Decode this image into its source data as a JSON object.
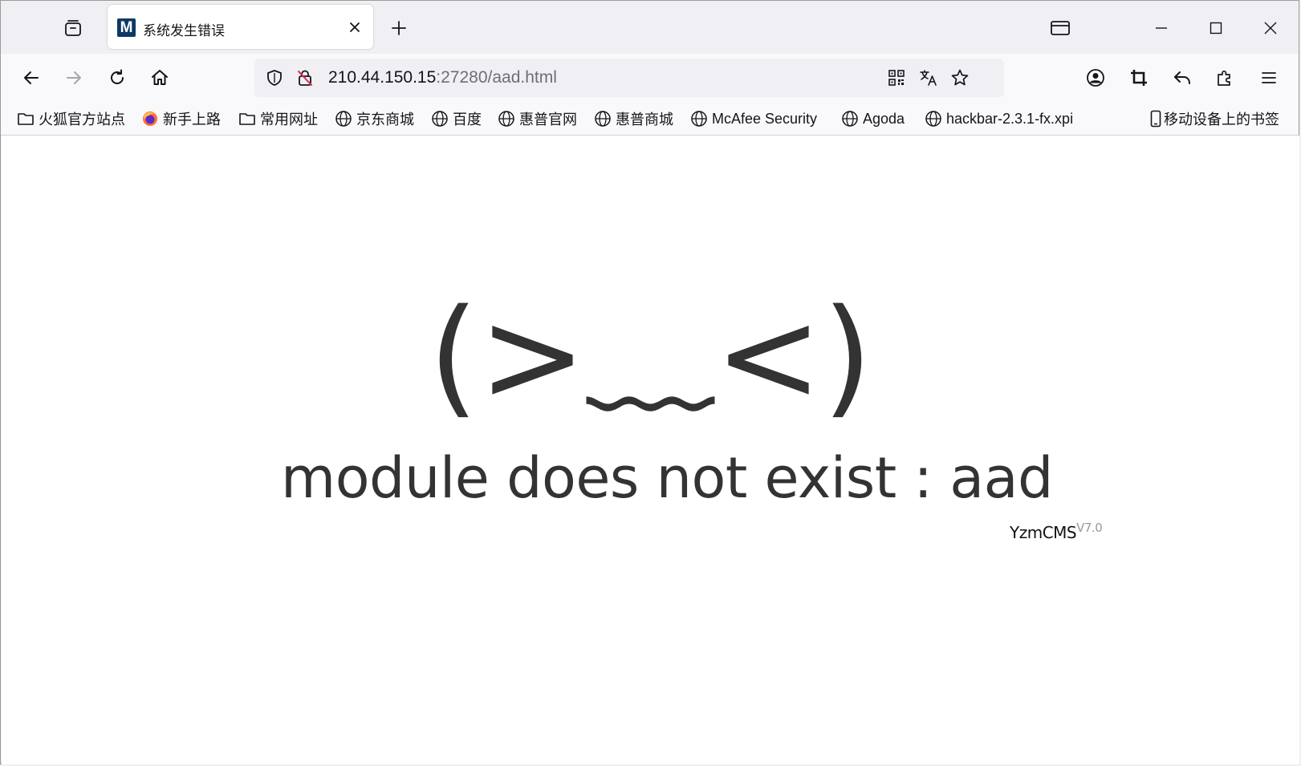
{
  "browser": {
    "tab": {
      "favicon_letter": "M",
      "title": "系统发生错误"
    },
    "address": {
      "host": "210.44.150.15",
      "rest": ":27280/aad.html"
    },
    "bookmarks": [
      {
        "label": "火狐官方站点",
        "icon": "folder-icon"
      },
      {
        "label": "新手上路",
        "icon": "firefox-icon"
      },
      {
        "label": "常用网址",
        "icon": "folder-icon"
      },
      {
        "label": "京东商城",
        "icon": "globe-icon"
      },
      {
        "label": "百度",
        "icon": "globe-icon"
      },
      {
        "label": "惠普官网",
        "icon": "globe-icon"
      },
      {
        "label": "惠普商城",
        "icon": "globe-icon"
      },
      {
        "label": "McAfee Security",
        "icon": "globe-icon"
      },
      {
        "label": "Agoda",
        "icon": "globe-icon"
      },
      {
        "label": "hackbar-2.3.1-fx.xpi",
        "icon": "globe-icon"
      }
    ],
    "mobile_bookmarks": "移动设备上的书签"
  },
  "page": {
    "face": "(>﹏<)",
    "message": "module does not exist : aad",
    "brand": "YzmCMS",
    "version": "V7.0"
  },
  "colors": {
    "favicon_bg": "#0c3a66",
    "text": "#333333",
    "accent_blue": "#0060df"
  }
}
